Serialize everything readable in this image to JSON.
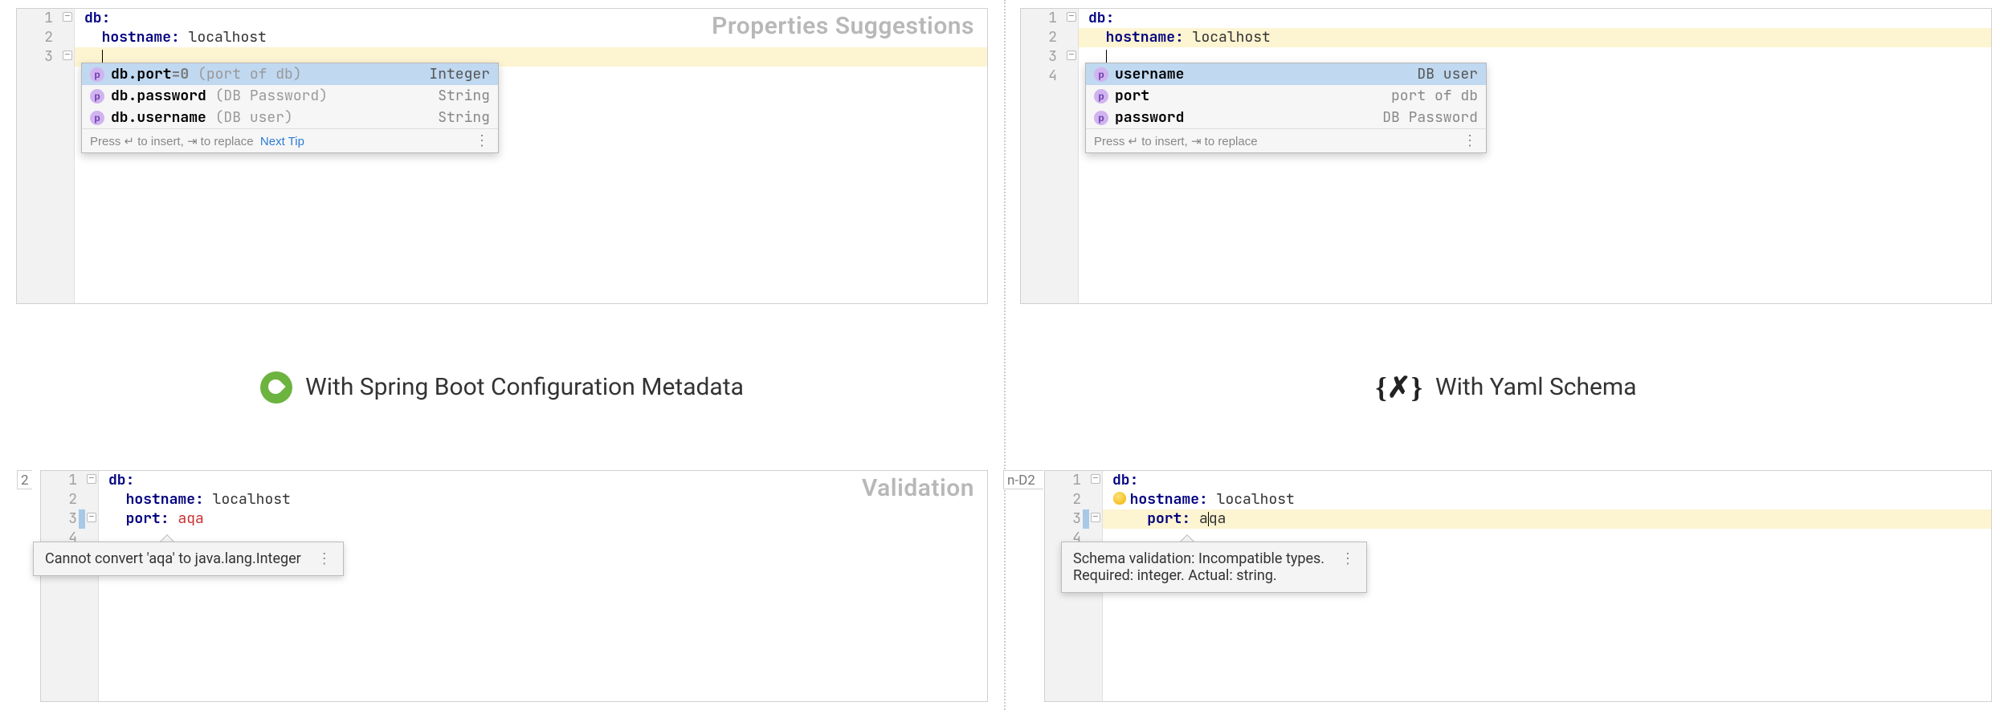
{
  "labels": {
    "suggestions": "Properties Suggestions",
    "validation": "Validation",
    "spring_title": "With Spring Boot Configuration Metadata",
    "yaml_title": "With Yaml Schema"
  },
  "left_top": {
    "lines": [
      {
        "num": "1",
        "key": "db",
        "colon": ":",
        "val": ""
      },
      {
        "num": "2",
        "key": "hostname",
        "colon": ":",
        "val": "localhost"
      },
      {
        "num": "3",
        "key": "",
        "colon": "",
        "val": ""
      }
    ],
    "completion": {
      "items": [
        {
          "name": "db.port",
          "default": "=0",
          "desc": "(port of db)",
          "type": "Integer",
          "selected": true
        },
        {
          "name": "db.password",
          "default": "",
          "desc": "(DB Password)",
          "type": "String",
          "selected": false
        },
        {
          "name": "db.username",
          "default": "",
          "desc": "(DB user)",
          "type": "String",
          "selected": false
        }
      ],
      "footer_hint": "Press ↵ to insert, ⇥ to replace",
      "next_tip": "Next Tip"
    }
  },
  "right_top": {
    "lines": [
      {
        "num": "1",
        "key": "db",
        "colon": ":",
        "val": ""
      },
      {
        "num": "2",
        "key": "hostname",
        "colon": ":",
        "val": "localhost"
      },
      {
        "num": "3",
        "key": "",
        "colon": "",
        "val": ""
      },
      {
        "num": "4",
        "key": "",
        "colon": "",
        "val": ""
      }
    ],
    "completion": {
      "items": [
        {
          "name": "username",
          "default": "",
          "desc": "",
          "type": "DB user",
          "selected": true
        },
        {
          "name": "port",
          "default": "",
          "desc": "",
          "type": "port of db",
          "selected": false
        },
        {
          "name": "password",
          "default": "",
          "desc": "",
          "type": "DB Password",
          "selected": false
        }
      ],
      "footer_hint": "Press ↵ to insert, ⇥ to replace",
      "next_tip": ""
    }
  },
  "left_bottom": {
    "tab_fragment": "2",
    "lines": [
      {
        "num": "1",
        "key": "db",
        "colon": ":",
        "val": ""
      },
      {
        "num": "2",
        "key": "hostname",
        "colon": ":",
        "val": "localhost"
      },
      {
        "num": "3",
        "key": "port",
        "colon": ":",
        "val": "aqa",
        "err": true
      },
      {
        "num": "4",
        "key": "",
        "colon": "",
        "val": ""
      }
    ],
    "tooltip": "Cannot convert 'aqa' to java.lang.Integer"
  },
  "right_bottom": {
    "tab_fragment": "n-D2",
    "lines": [
      {
        "num": "1",
        "key": "db",
        "colon": ":",
        "val": ""
      },
      {
        "num": "2",
        "key": "hostname",
        "colon": ":",
        "val": "localhost"
      },
      {
        "num": "3",
        "key": "port",
        "colon": ":",
        "val": "aqa",
        "caret_in_val": true
      },
      {
        "num": "4",
        "key": "",
        "colon": "",
        "val": ""
      }
    ],
    "tooltip": "Schema validation: Incompatible types.\nRequired: integer. Actual: string."
  }
}
